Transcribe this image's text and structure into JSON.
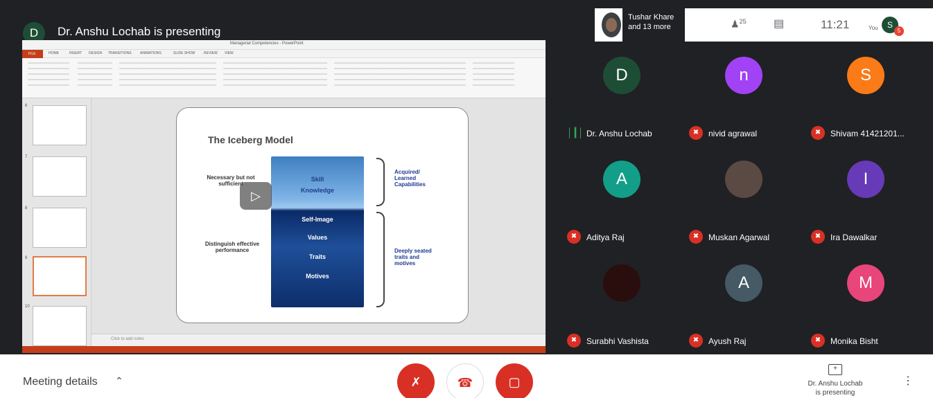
{
  "presentation": {
    "presenter_initial": "D",
    "title": "Dr. Anshu Lochab is presenting"
  },
  "shared_screen": {
    "window_title": "Managerial Competencies - PowerPoint",
    "file_tab": "FILE",
    "ribbon_tabs": [
      "HOME",
      "INSERT",
      "DESIGN",
      "TRANSITIONS",
      "ANIMATIONS",
      "SLIDE SHOW",
      "REVIEW",
      "VIEW"
    ],
    "slide_numbers": [
      "6",
      "7",
      "8",
      "9",
      "10"
    ],
    "notes_placeholder": "Click to add notes",
    "slide": {
      "title": "The Iceberg Model",
      "iceberg_labels": [
        "Skill",
        "Knowledge",
        "Self-Image",
        "Values",
        "Traits",
        "Motives"
      ],
      "left_top": "Necessary but not sufficient",
      "left_bottom": "Distinguish effective performance",
      "right_top": "Acquired/ Learned Capabilities",
      "right_bottom": "Deeply seated traits and motives"
    }
  },
  "topbar": {
    "names_line1": "Tushar Khare",
    "names_line2": "and 13 more",
    "people_count": "25",
    "time": "11:21",
    "you_label": "You",
    "self_initial": "S",
    "notification_count": "5"
  },
  "participants": [
    {
      "initial": "D",
      "name": "Dr. Anshu Lochab",
      "color": "#1e4d36",
      "muted": false
    },
    {
      "initial": "n",
      "name": "nivid agrawal",
      "color": "#a142f4",
      "muted": true
    },
    {
      "initial": "S",
      "name": "Shivam 41421201...",
      "color": "#fa7b17",
      "muted": true
    },
    {
      "initial": "A",
      "name": "Aditya Raj",
      "color": "#129e88",
      "muted": true
    },
    {
      "initial": "",
      "name": "Muskan Agarwal",
      "color": "#5b4a44",
      "muted": true
    },
    {
      "initial": "I",
      "name": "Ira Dawalkar",
      "color": "#673ab7",
      "muted": true
    },
    {
      "initial": "",
      "name": "Surabhi Vashista",
      "color": "#2a0e0e",
      "muted": true
    },
    {
      "initial": "A",
      "name": "Ayush Raj",
      "color": "#455a64",
      "muted": true
    },
    {
      "initial": "M",
      "name": "Monika Bisht",
      "color": "#e8457a",
      "muted": true
    }
  ],
  "bottombar": {
    "meeting_details": "Meeting details",
    "present_line1": "Dr. Anshu Lochab",
    "present_line2": "is presenting"
  },
  "colors": {
    "accent_red": "#d93025",
    "meet_dark": "#202124"
  }
}
